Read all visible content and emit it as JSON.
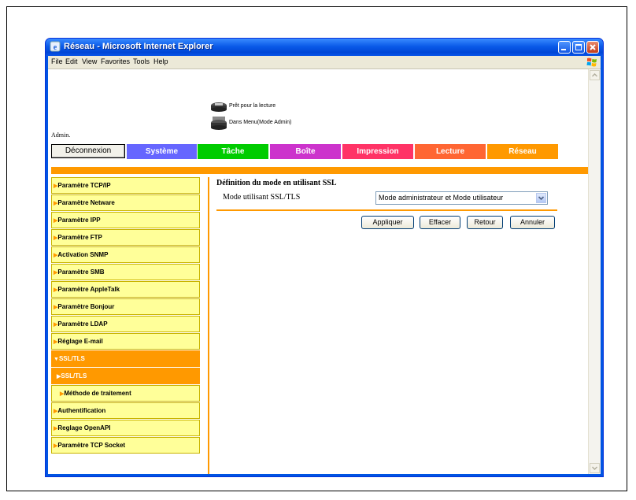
{
  "window": {
    "title": "Réseau - Microsoft Internet Explorer"
  },
  "menu": [
    "File",
    "Edit",
    "View",
    "Favorites",
    "Tools",
    "Help"
  ],
  "status": {
    "line1": "Prêt pour la lecture",
    "line2": "Dans Menu(Mode Admin)"
  },
  "admin_label": "Admin.",
  "logout_label": "Déconnexion",
  "tabs": [
    {
      "label": "Système",
      "color": "#6666ff"
    },
    {
      "label": "Tâche",
      "color": "#00cc00"
    },
    {
      "label": "Boîte",
      "color": "#cc33cc"
    },
    {
      "label": "Impression",
      "color": "#ff3366"
    },
    {
      "label": "Lecture",
      "color": "#ff6633"
    },
    {
      "label": "Réseau",
      "color": "#ff9900"
    }
  ],
  "sidebar": [
    {
      "label": "Paramètre TCP/IP",
      "state": "normal"
    },
    {
      "label": "Paramètre Netware",
      "state": "normal"
    },
    {
      "label": "Paramètre IPP",
      "state": "normal"
    },
    {
      "label": "Paramètre FTP",
      "state": "normal"
    },
    {
      "label": "Activation SNMP",
      "state": "normal"
    },
    {
      "label": "Paramètre SMB",
      "state": "normal"
    },
    {
      "label": "Paramètre AppleTalk",
      "state": "normal"
    },
    {
      "label": "Paramètre Bonjour",
      "state": "normal"
    },
    {
      "label": "Paramètre LDAP",
      "state": "normal"
    },
    {
      "label": "Réglage E-mail",
      "state": "normal"
    },
    {
      "label": "SSL/TLS",
      "state": "expanded"
    },
    {
      "label": "SSL/TLS",
      "state": "selected"
    },
    {
      "label": "Méthode de traitement",
      "state": "sub"
    },
    {
      "label": "Authentification",
      "state": "normal"
    },
    {
      "label": "Reglage OpenAPI",
      "state": "normal"
    },
    {
      "label": "Paramètre TCP Socket",
      "state": "normal"
    }
  ],
  "main": {
    "section_title": "Définition du mode en utilisant SSL",
    "field_label": "Mode utilisant SSL/TLS",
    "select_value": "Mode administrateur et Mode utilisateur",
    "buttons": [
      "Appliquer",
      "Effacer",
      "Retour",
      "Annuler"
    ]
  }
}
